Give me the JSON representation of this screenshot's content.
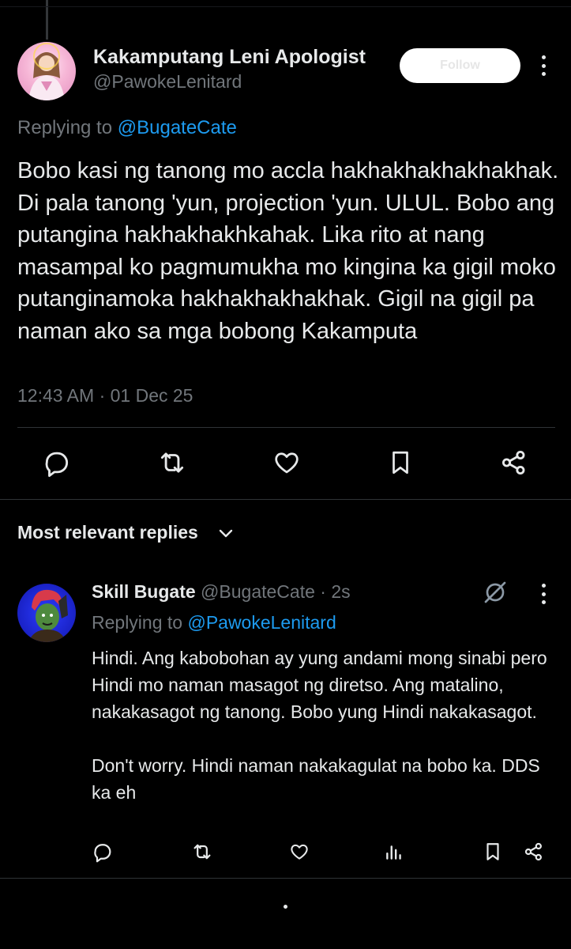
{
  "tweet": {
    "author_name": "Kakamputang Leni Apologist",
    "author_handle": "@PawokeLenitard",
    "follow_button_label": "Follow",
    "replying_prefix": "Replying to ",
    "replying_to": "@BugateCate",
    "text": "Bobo kasi ng tanong mo accla hakhakhakhakhakhak. Di pala tanong 'yun, projection 'yun. ULUL. Bobo ang putangina hakhakhakhkahak. Lika rito at nang masampal ko pagmumukha mo kingina ka gigil moko putanginamoka hakhakhakhakhak. Gigil na gigil pa naman ako sa mga bobong Kakamputa",
    "timestamp": "12:43 AM · 01 Dec 25",
    "actions": [
      "reply-icon",
      "retweet-icon",
      "like-icon",
      "bookmark-icon",
      "share-icon"
    ]
  },
  "replies_section": {
    "label": "Most relevant replies"
  },
  "reply": {
    "author_name": "Skill Bugate",
    "author_meta": " @BugateCate · 2s",
    "replying_prefix": "Replying to ",
    "replying_to": "@PawokeLenitard",
    "text": "Hindi. Ang kabobohan ay yung andami mong sinabi pero Hindi mo naman masagot ng diretso. Ang matalino, nakakasagot ng tanong. Bobo yung Hindi nakakasagot.\n\nDon't worry. Hindi naman nakakagulat na bobo ka. DDS ka eh",
    "actions": [
      "reply-icon",
      "retweet-icon",
      "like-icon",
      "views-icon",
      "bookmark-icon",
      "share-icon"
    ]
  },
  "colors": {
    "background": "#000000",
    "text": "#e7e9ea",
    "secondary": "#71767b",
    "link": "#1d9bf0",
    "divider": "#2f3336"
  }
}
